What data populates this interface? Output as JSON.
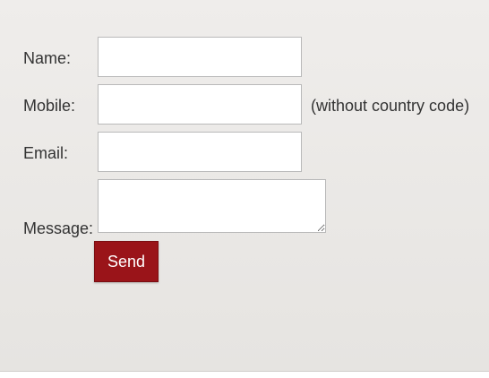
{
  "form": {
    "name_label": "Name:",
    "name_value": "",
    "mobile_label": "Mobile:",
    "mobile_value": "",
    "mobile_hint": "(without country code)",
    "email_label": "Email:",
    "email_value": "",
    "message_label": "Message:",
    "message_value": "",
    "send_label": "Send"
  },
  "colors": {
    "panel_background": "#ebe9e6",
    "button_background": "#9a1419",
    "button_text": "#ffffff",
    "label_text": "#333333",
    "field_border": "#b9b9b9"
  }
}
